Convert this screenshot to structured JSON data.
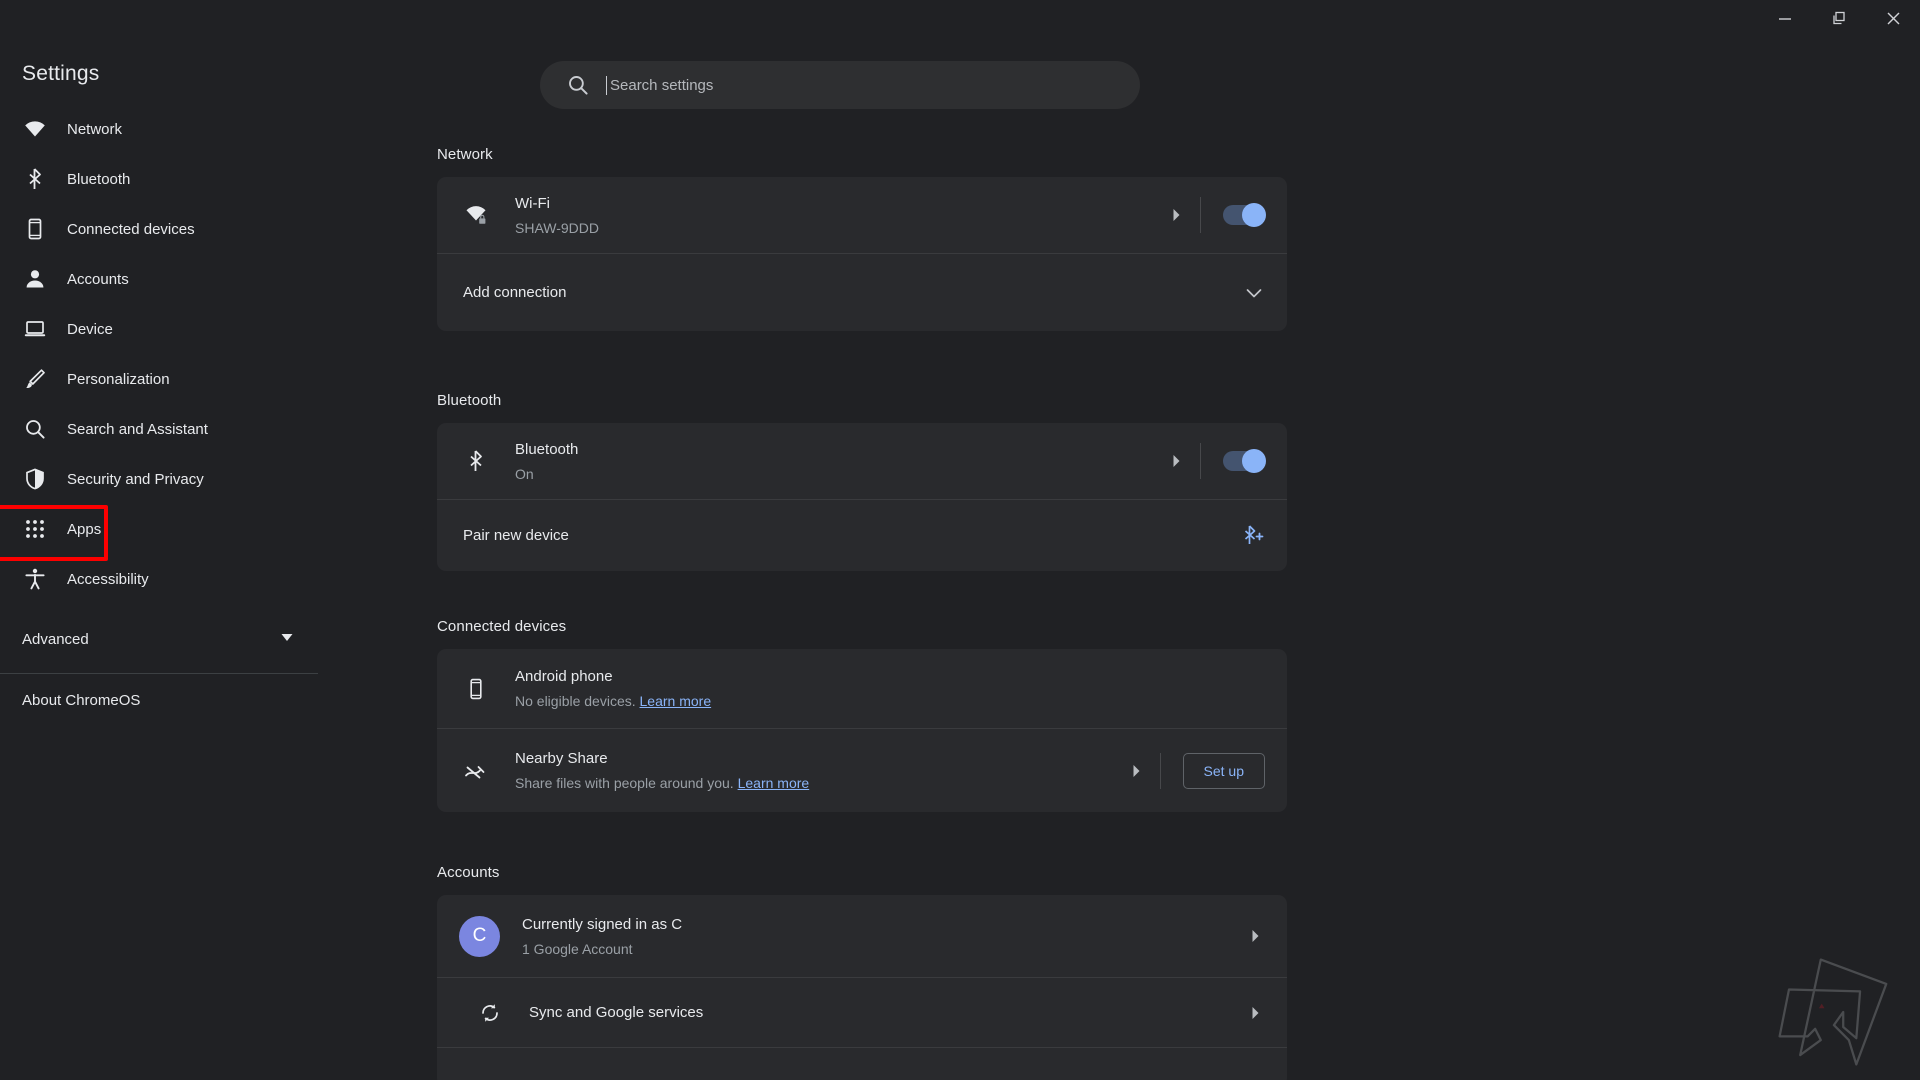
{
  "window": {
    "minimize_label": "Minimize",
    "restore_label": "Restore",
    "close_label": "Close"
  },
  "sidebar": {
    "title": "Settings",
    "items": [
      {
        "label": "Network",
        "icon": "wifi-icon"
      },
      {
        "label": "Bluetooth",
        "icon": "bluetooth-icon"
      },
      {
        "label": "Connected devices",
        "icon": "phone-icon"
      },
      {
        "label": "Accounts",
        "icon": "person-icon"
      },
      {
        "label": "Device",
        "icon": "laptop-icon"
      },
      {
        "label": "Personalization",
        "icon": "brush-icon"
      },
      {
        "label": "Search and Assistant",
        "icon": "search-icon"
      },
      {
        "label": "Security and Privacy",
        "icon": "shield-icon"
      },
      {
        "label": "Apps",
        "icon": "apps-grid-icon"
      },
      {
        "label": "Accessibility",
        "icon": "accessibility-icon"
      }
    ],
    "highlighted_item": "Apps",
    "highlight_color": "#fd0000",
    "advanced": {
      "label": "Advanced",
      "icon": "chevron-down-icon"
    },
    "about": {
      "label": "About ChromeOS"
    }
  },
  "search": {
    "placeholder": "Search settings",
    "value": "",
    "icon": "search-icon"
  },
  "sections": {
    "network": {
      "title": "Network",
      "wifi": {
        "name": "Wi-Fi",
        "ssid": "SHAW-9DDD",
        "icon": "wifi-lock-icon",
        "toggle_on": true
      },
      "add_connection": {
        "label": "Add connection",
        "icon": "chevron-down-icon"
      }
    },
    "bluetooth": {
      "title": "Bluetooth",
      "device": {
        "name": "Bluetooth",
        "status": "On",
        "icon": "bluetooth-icon",
        "toggle_on": true
      },
      "pair": {
        "label": "Pair new device",
        "icon": "bluetooth-plus-icon"
      }
    },
    "connected_devices": {
      "title": "Connected devices",
      "android": {
        "name": "Android phone",
        "status": "No eligible devices.",
        "link": "Learn more",
        "icon": "phone-icon"
      },
      "nearby_share": {
        "name": "Nearby Share",
        "status": "Share files with people around you.",
        "link": "Learn more",
        "icon": "nearby-share-icon",
        "button": "Set up"
      }
    },
    "accounts": {
      "title": "Accounts",
      "signed_in": {
        "primary": "Currently signed in as C",
        "secondary": "1 Google Account",
        "avatar_initial": "C",
        "avatar_color": "#7b86e0"
      },
      "sync": {
        "label": "Sync and Google services",
        "icon": "sync-icon"
      }
    }
  },
  "colors": {
    "page_background": "#202124",
    "card_background": "#292a2d",
    "accent_blue": "#8ab4f8",
    "text_primary": "#e8eaed",
    "text_secondary": "#9aa0a6"
  },
  "watermark": {
    "name": "angular-logo-watermark"
  }
}
